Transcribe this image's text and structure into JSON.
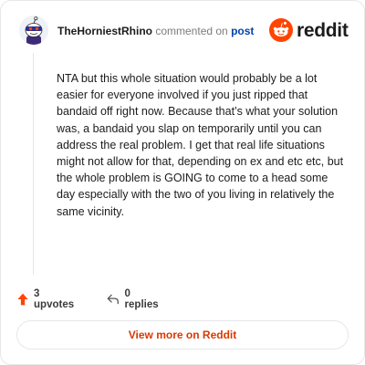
{
  "header": {
    "username": "TheHorniestRhino",
    "action_text": "commented on",
    "post_link": "post",
    "brand": "reddit"
  },
  "comment": {
    "body": "NTA but this whole situation would probably be a lot easier for everyone involved if you just ripped that bandaid off right now. Because that’s what your solution was, a bandaid you slap on temporarily until you can address the real problem. I get that real life situations might not allow for that, depending on ex and etc etc, but the whole problem is GOING to come to a head some day especially with the two of you living in relatively the same vicinity."
  },
  "actions": {
    "upvotes": "3 upvotes",
    "replies": "0 replies"
  },
  "cta": {
    "label": "View more on Reddit"
  },
  "icons": {
    "avatar": "snoo-avatar-icon",
    "logo": "reddit-logo-icon",
    "upvote": "upvote-arrow-icon",
    "reply": "reply-arrow-icon"
  },
  "colors": {
    "brand_orange": "#ff4500",
    "link_blue": "#0045ac",
    "cta_text": "#d93900",
    "upvote_arrow": "#ff4500"
  }
}
